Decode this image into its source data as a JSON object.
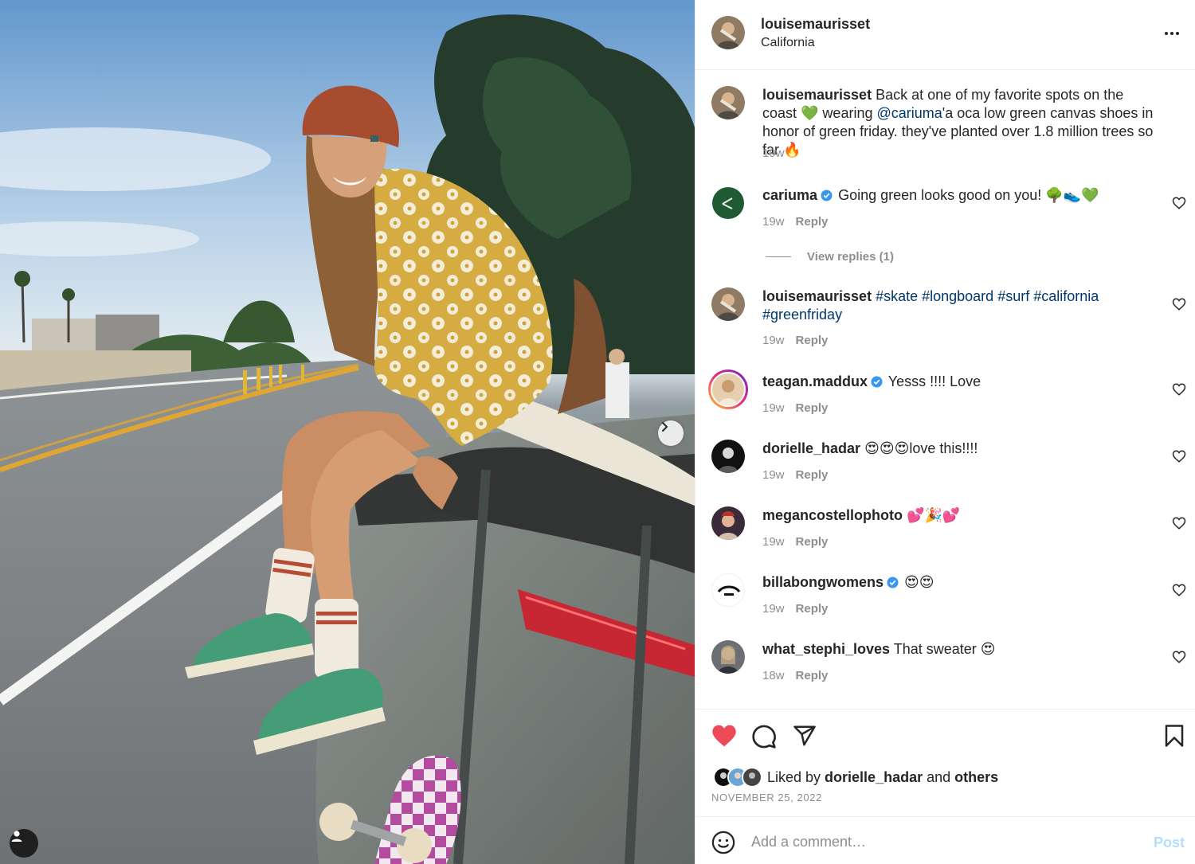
{
  "header": {
    "username": "louisemaurisset",
    "location": "California",
    "more_icon": "more-horizontal-icon"
  },
  "caption": {
    "username": "louisemaurisset",
    "text_1": " Back at one of my favorite spots on the coast 💚 wearing ",
    "mention": "@cariuma",
    "text_2": "'a oca low green canvas shoes in honor of green friday. they've planted over 1.8 million trees so far 🔥",
    "time": "19w"
  },
  "comments": [
    {
      "username": "cariuma",
      "verified": true,
      "text": "Going green looks good on you! 🌳👟💚",
      "time": "19w",
      "reply": "Reply",
      "view_replies": "View replies (1)"
    },
    {
      "username": "louisemaurisset",
      "verified": false,
      "hashtags_1": "#skate #longboard #surf #california",
      "hashtags_2": "#greenfriday",
      "time": "19w",
      "reply": "Reply"
    },
    {
      "username": "teagan.maddux",
      "verified": true,
      "text": "Yesss !!!! Love",
      "time": "19w",
      "reply": "Reply"
    },
    {
      "username": "dorielle_hadar",
      "verified": false,
      "text": "😍😍😍love this!!!!",
      "time": "19w",
      "reply": "Reply"
    },
    {
      "username": "megancostellophoto",
      "verified": false,
      "text": "💕🎉💕",
      "time": "19w",
      "reply": "Reply"
    },
    {
      "username": "billabongwomens",
      "verified": true,
      "text": "😍😍",
      "time": "19w",
      "reply": "Reply"
    },
    {
      "username": "what_stephi_loves",
      "verified": false,
      "text": "That sweater 😍",
      "time": "18w",
      "reply": "Reply"
    }
  ],
  "actions": {
    "liked_prefix": "Liked by ",
    "liked_user": "dorielle_hadar",
    "liked_and": " and ",
    "liked_others": "others",
    "date": "NOVEMBER 25, 2022",
    "liked": true
  },
  "add_comment": {
    "placeholder": "Add a comment…",
    "post_label": "Post"
  },
  "colors": {
    "like_red": "#ed4956",
    "link_blue": "#00376b",
    "verified_blue": "#3897f0",
    "post_disabled": "#b2dffc"
  }
}
